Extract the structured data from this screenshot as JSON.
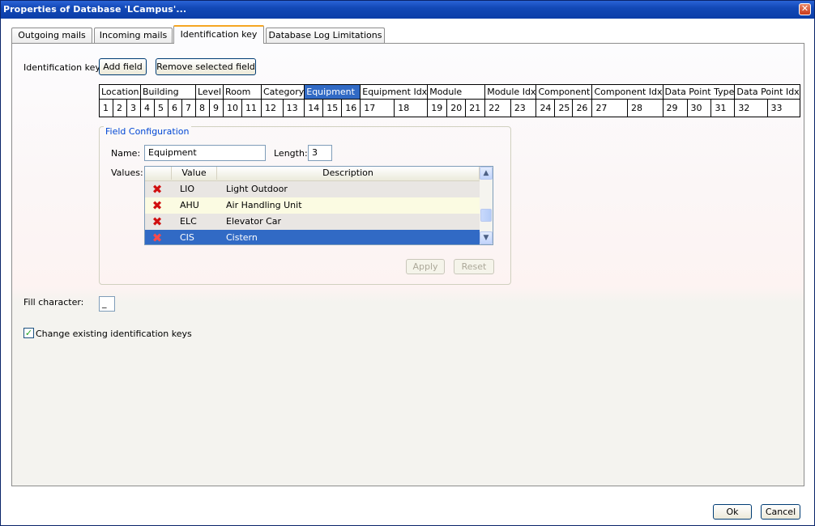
{
  "window": {
    "title": "Properties of Database 'LCampus'..."
  },
  "tabs": [
    {
      "label": "Outgoing mails"
    },
    {
      "label": "Incoming mails"
    },
    {
      "label": "Identification key"
    },
    {
      "label": "Database Log Limitations"
    }
  ],
  "id_key": {
    "label": "Identification key:",
    "add_field": "Add field",
    "remove_field": "Remove selected field",
    "fields": [
      {
        "name": "Location",
        "positions": [
          "1",
          "2",
          "3"
        ]
      },
      {
        "name": "Building",
        "positions": [
          "4",
          "5",
          "6",
          "7"
        ]
      },
      {
        "name": "Level",
        "positions": [
          "8",
          "9"
        ]
      },
      {
        "name": "Room",
        "positions": [
          "10",
          "11"
        ]
      },
      {
        "name": "Category",
        "positions": [
          "12",
          "13"
        ]
      },
      {
        "name": "Equipment",
        "positions": [
          "14",
          "15",
          "16"
        ]
      },
      {
        "name": "Equipment Idx",
        "positions": [
          "17",
          "18"
        ]
      },
      {
        "name": "Module",
        "positions": [
          "19",
          "20",
          "21"
        ]
      },
      {
        "name": "Module Idx",
        "positions": [
          "22",
          "23"
        ]
      },
      {
        "name": "Component",
        "positions": [
          "24",
          "25",
          "26"
        ]
      },
      {
        "name": "Component Idx",
        "positions": [
          "27",
          "28"
        ]
      },
      {
        "name": "Data Point Type",
        "positions": [
          "29",
          "30",
          "31"
        ]
      },
      {
        "name": "Data Point Idx",
        "positions": [
          "32",
          "33"
        ]
      }
    ],
    "selected_field": "Equipment"
  },
  "field_config": {
    "legend": "Field Configuration",
    "name_label": "Name:",
    "name_value": "Equipment",
    "length_label": "Length:",
    "length_value": "3",
    "values_label": "Values:",
    "columns": {
      "value": "Value",
      "description": "Description"
    },
    "rows": [
      {
        "value": "LIO",
        "description": "Light Outdoor"
      },
      {
        "value": "AHU",
        "description": "Air Handling Unit"
      },
      {
        "value": "ELC",
        "description": "Elevator Car"
      },
      {
        "value": "CIS",
        "description": "Cistern"
      }
    ],
    "selected_row": "CIS",
    "apply": "Apply",
    "reset": "Reset"
  },
  "fill_char": {
    "label": "Fill character:",
    "value": "_"
  },
  "change_existing": {
    "label": "Change existing identification keys",
    "checked": true
  },
  "footer": {
    "ok": "Ok",
    "cancel": "Cancel"
  },
  "colors": {
    "selection": "#316ac5",
    "title_bar": "#0b3ea8",
    "legend": "#0046d5"
  }
}
